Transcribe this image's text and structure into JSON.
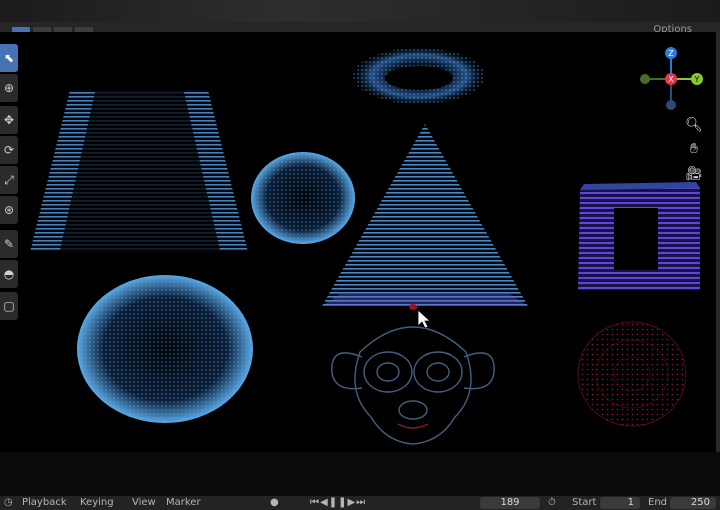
{
  "header": {
    "options_label": "Options"
  },
  "navigation_gizmo": {
    "axis_z": "Z",
    "axis_x": "X",
    "axis_y": "Y"
  },
  "toolbar": {
    "tools": [
      {
        "icon": "select-cursor-icon",
        "glyph": "⬉"
      },
      {
        "icon": "cursor-icon",
        "glyph": "⊕"
      },
      {
        "icon": "move-icon",
        "glyph": "✥"
      },
      {
        "icon": "rotate-icon",
        "glyph": "⟳"
      },
      {
        "icon": "scale-icon",
        "glyph": "⤢"
      },
      {
        "icon": "transform-icon",
        "glyph": "⊛"
      },
      {
        "icon": "annotate-icon",
        "glyph": "✎"
      },
      {
        "icon": "measure-icon",
        "glyph": "◓"
      },
      {
        "icon": "add-cube-icon",
        "glyph": "▢"
      }
    ]
  },
  "viewport_nav": {
    "zoom_glyph": "🔍︎",
    "pan_glyph": "✋︎",
    "camera_glyph": "🎥︎"
  },
  "timeline": {
    "playback_label": "Playback",
    "keying_label": "Keying",
    "view_label": "View",
    "marker_label": "Marker",
    "current_frame": "189",
    "start_label": "Start",
    "start_value": "1",
    "end_label": "End",
    "end_value": "250"
  },
  "colors": {
    "accent": "#4772b3",
    "axis_x": "#e8334a",
    "axis_y": "#8ac926",
    "axis_z": "#2d7bd8",
    "particles_blue": "#5aa9e6",
    "particles_purple": "#7a4ff0",
    "particles_red": "#9b1b3a"
  }
}
